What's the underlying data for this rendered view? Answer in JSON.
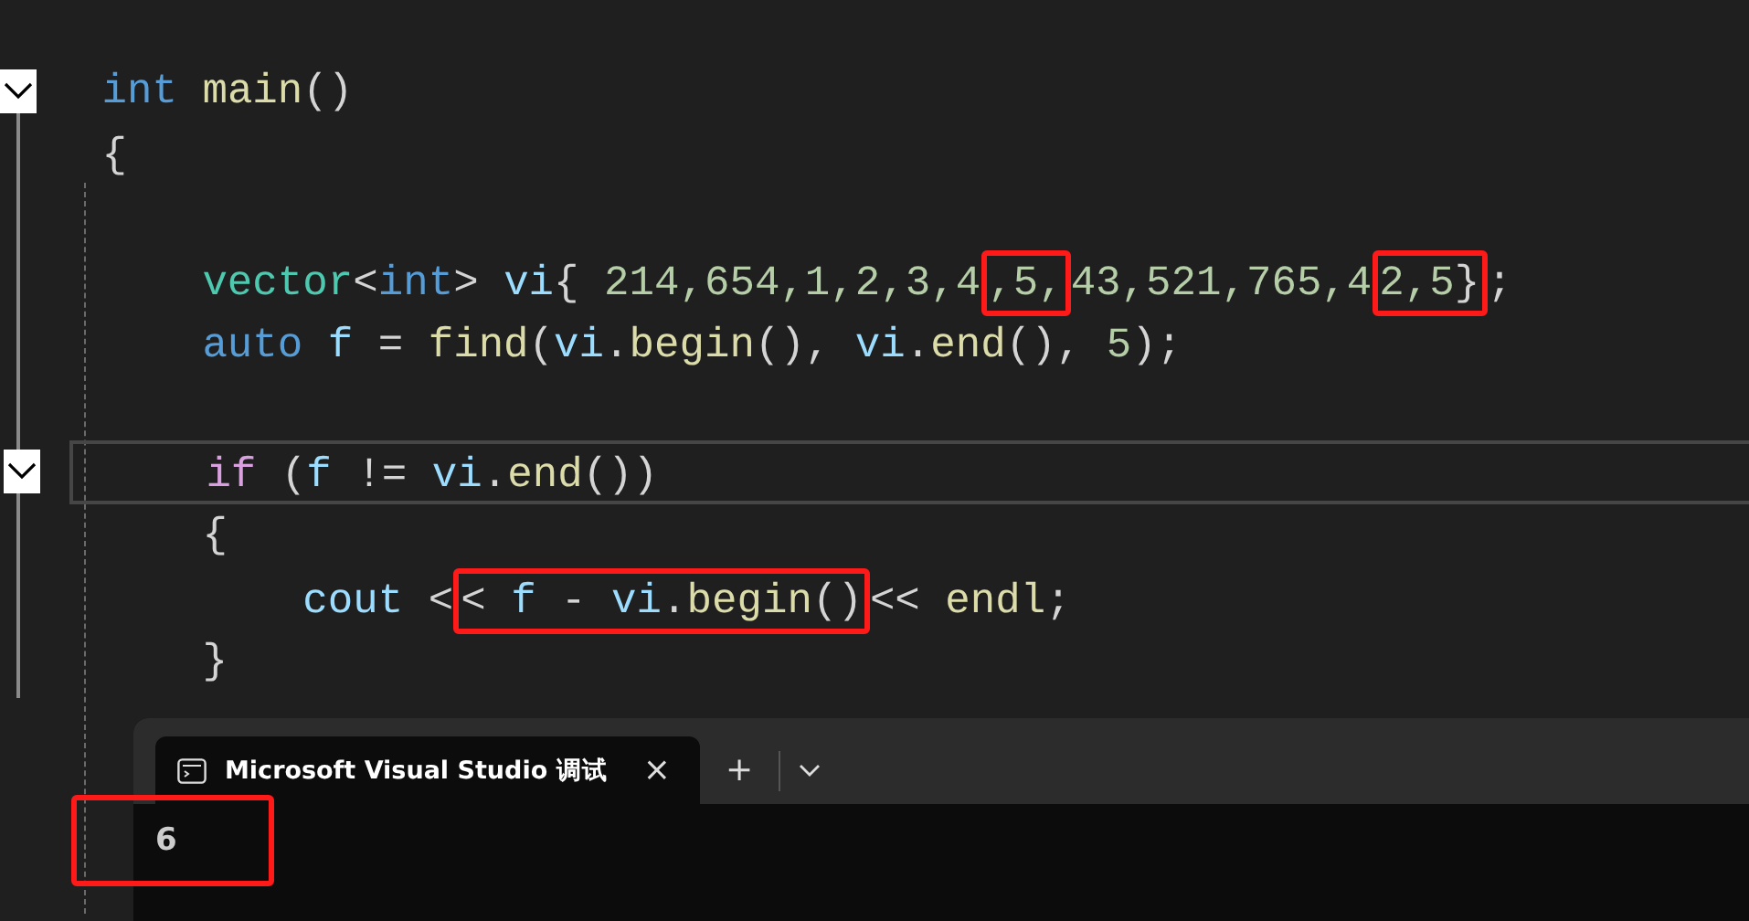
{
  "code_lines": [
    {
      "fold": true,
      "current": false,
      "tokens": [
        {
          "text": "int",
          "kind": "keyword"
        },
        {
          "text": " main",
          "kind": "function"
        },
        {
          "text": "()",
          "kind": "plain"
        }
      ]
    },
    {
      "fold": false,
      "current": false,
      "tokens": [
        {
          "text": "{",
          "kind": "plain"
        }
      ],
      "children": [
        {
          "fold": false,
          "current": false
        },
        {
          "fold": false,
          "current": false,
          "tokens": [
            {
              "text": "vector",
              "kind": "type"
            },
            {
              "text": "<",
              "kind": "plain"
            },
            {
              "text": "int",
              "kind": "keyword"
            },
            {
              "text": ">",
              "kind": "plain"
            },
            {
              "text": " vi",
              "kind": "variable"
            },
            {
              "text": "{ ",
              "kind": "plain"
            },
            {
              "text": "214,654,1,2,3,4",
              "kind": "number"
            },
            {
              "kind": "marked",
              "tokens": [
                {
                  "text": ",5,",
                  "kind": "number"
                }
              ]
            },
            {
              "text": "43,521,765,4",
              "kind": "number"
            },
            {
              "kind": "marked",
              "tokens": [
                {
                  "text": "2,5",
                  "kind": "number"
                },
                {
                  "text": "}",
                  "kind": "plain"
                }
              ]
            },
            {
              "text": ";",
              "kind": "plain"
            }
          ]
        },
        {
          "fold": false,
          "current": false,
          "tokens": [
            {
              "text": "auto",
              "kind": "keyword"
            },
            {
              "text": " f",
              "kind": "variable"
            },
            {
              "text": " = ",
              "kind": "plain"
            },
            {
              "text": "find",
              "kind": "function"
            },
            {
              "text": "(",
              "kind": "plain"
            },
            {
              "text": "vi",
              "kind": "variable"
            },
            {
              "text": ".",
              "kind": "plain"
            },
            {
              "text": "begin",
              "kind": "function"
            },
            {
              "text": "(), ",
              "kind": "plain"
            },
            {
              "text": "vi",
              "kind": "variable"
            },
            {
              "text": ".",
              "kind": "plain"
            },
            {
              "text": "end",
              "kind": "function"
            },
            {
              "text": "(), ",
              "kind": "plain"
            },
            {
              "text": "5",
              "kind": "number"
            },
            {
              "text": ");",
              "kind": "plain"
            }
          ]
        },
        {
          "fold": false,
          "current": false
        },
        {
          "fold": true,
          "current": true,
          "tokens": [
            {
              "text": "if",
              "kind": "control"
            },
            {
              "text": " (",
              "kind": "plain"
            },
            {
              "text": "f",
              "kind": "variable"
            },
            {
              "text": " != ",
              "kind": "plain"
            },
            {
              "text": "vi",
              "kind": "variable"
            },
            {
              "text": ".",
              "kind": "plain"
            },
            {
              "text": "end",
              "kind": "function"
            },
            {
              "text": "())",
              "kind": "plain"
            }
          ]
        },
        {
          "fold": false,
          "current": false,
          "tokens": [
            {
              "text": "{",
              "kind": "plain"
            }
          ],
          "children": [
            {
              "fold": false,
              "current": false,
              "tokens": [
                {
                  "text": "cout",
                  "kind": "variable"
                },
                {
                  "text": " <",
                  "kind": "plain"
                },
                {
                  "kind": "marked",
                  "tokens": [
                    {
                      "text": "< ",
                      "kind": "plain"
                    },
                    {
                      "text": "f",
                      "kind": "variable"
                    },
                    {
                      "text": " - ",
                      "kind": "plain"
                    },
                    {
                      "text": "vi",
                      "kind": "variable"
                    },
                    {
                      "text": ".",
                      "kind": "plain"
                    },
                    {
                      "text": "begin",
                      "kind": "function"
                    },
                    {
                      "text": "()",
                      "kind": "plain"
                    }
                  ]
                },
                {
                  "text": "<< ",
                  "kind": "plain"
                },
                {
                  "text": "endl",
                  "kind": "function"
                },
                {
                  "text": ";",
                  "kind": "plain"
                }
              ]
            }
          ]
        },
        {
          "fold": false,
          "current": false,
          "tokens": [
            {
              "text": "}",
              "kind": "plain"
            }
          ]
        }
      ]
    }
  ],
  "terminal": {
    "tab_title": "Microsoft Visual Studio 调试",
    "close": "×",
    "new_tab": "+",
    "output": [
      {
        "kind": "marked",
        "text": "6"
      }
    ]
  }
}
